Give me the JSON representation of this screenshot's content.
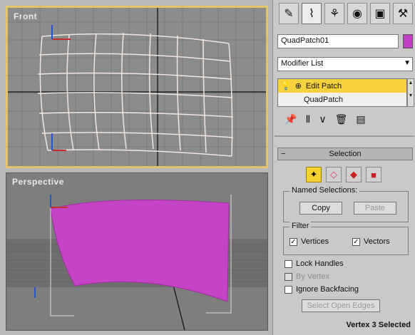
{
  "viewports": {
    "front": {
      "label": "Front"
    },
    "perspective": {
      "label": "Perspective"
    }
  },
  "command_panel": {
    "tabs": [
      "create",
      "modify",
      "hierarchy",
      "motion",
      "display",
      "utilities"
    ],
    "object_name": "QuadPatch01",
    "object_color": "#c23fc4",
    "modifier_list": "Modifier List",
    "stack": [
      {
        "label": "Edit Patch",
        "selected": true
      },
      {
        "label": "QuadPatch",
        "selected": false
      }
    ],
    "selection_rollout": {
      "title": "Selection",
      "named_selections_title": "Named Selections:",
      "copy_label": "Copy",
      "paste_label": "Paste",
      "filter_title": "Filter",
      "vertices_label": "Vertices",
      "vectors_label": "Vectors",
      "lock_handles_label": "Lock Handles",
      "by_vertex_label": "By Vertex",
      "ignore_backfacing_label": "Ignore Backfacing",
      "select_open_edges_label": "Select Open Edges",
      "status": "Vertex 3 Selected"
    }
  }
}
